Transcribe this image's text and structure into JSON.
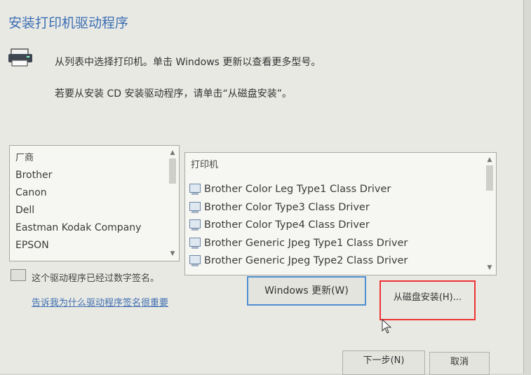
{
  "dialog": {
    "title": "安装打印机驱动程序",
    "instruction1": "从列表中选择打印机。单击 Windows 更新以查看更多型号。",
    "instruction2": "若要从安装 CD 安装驱动程序，请单击“从磁盘安装”。"
  },
  "manufacturers": {
    "header": "厂商",
    "items": [
      "Brother",
      "Canon",
      "Dell",
      "Eastman Kodak Company",
      "EPSON"
    ]
  },
  "printers": {
    "header": "打印机",
    "items": [
      "Brother Color Leg Type1 Class Driver",
      "Brother Color Type3 Class Driver",
      "Brother Color Type4 Class Driver",
      "Brother Generic Jpeg Type1 Class Driver",
      "Brother Generic Jpeg Type2 Class Driver"
    ]
  },
  "signature": {
    "text": "这个驱动程序已经过数字签名。",
    "link": "告诉我为什么驱动程序签名很重要"
  },
  "buttons": {
    "windows_update": "Windows 更新(W)",
    "have_disk": "从磁盘安装(H)...",
    "next": "下一步(N)",
    "cancel": "取消"
  },
  "colors": {
    "title": "#3c6fb3",
    "highlight": "#e33333",
    "focus": "#4d8fd1"
  }
}
